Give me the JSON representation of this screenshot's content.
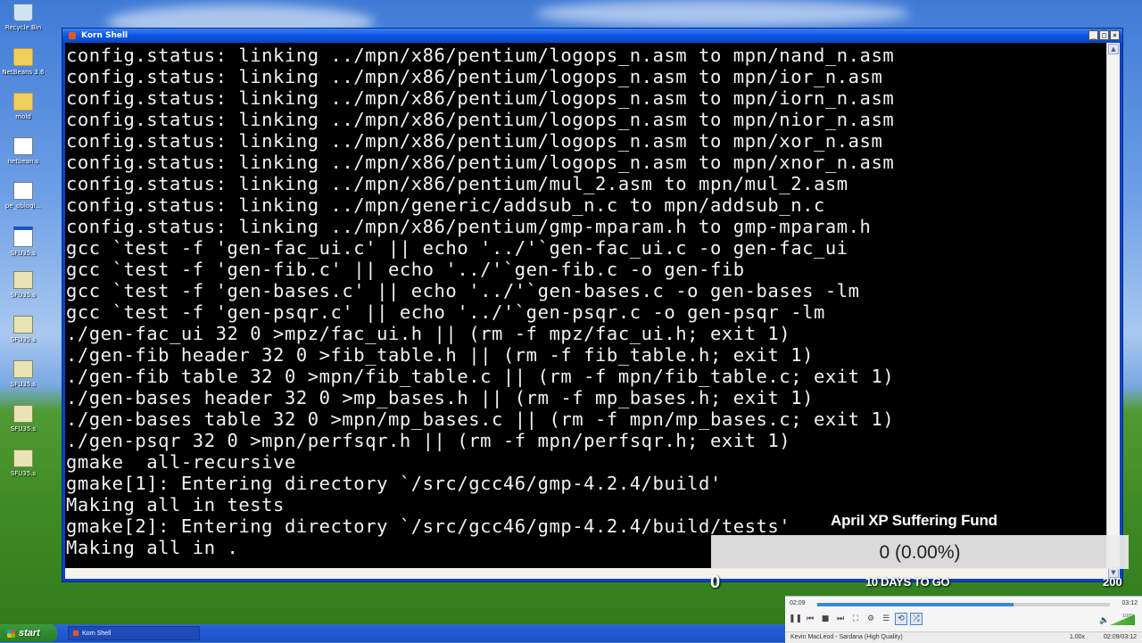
{
  "desktop": {
    "icons": [
      {
        "label": "Recycle Bin",
        "icon": "recycle-bin-icon"
      },
      {
        "label": "NetBeans 3.6",
        "icon": "folder-icon"
      },
      {
        "label": "mold",
        "icon": "folder-icon"
      },
      {
        "label": "netbean.s",
        "icon": "file-icon"
      },
      {
        "label": "pe_oblogi...",
        "icon": "file-icon"
      },
      {
        "label": "SFU35.s",
        "icon": "window-icon"
      },
      {
        "label": "SFU35.s",
        "icon": "program-icon"
      },
      {
        "label": "SFU35.s",
        "icon": "program-icon"
      },
      {
        "label": "SFU35.s",
        "icon": "program-icon"
      },
      {
        "label": "SFU35.s",
        "icon": "program-icon"
      },
      {
        "label": "SFU35.s",
        "icon": "program-icon"
      }
    ]
  },
  "window": {
    "title": "Korn Shell",
    "controls": {
      "minimize": "_",
      "maximize": "□",
      "close": "×"
    }
  },
  "terminal": {
    "lines": [
      "config.status: linking ../mpn/x86/pentium/logops_n.asm to mpn/nand_n.asm",
      "config.status: linking ../mpn/x86/pentium/logops_n.asm to mpn/ior_n.asm",
      "config.status: linking ../mpn/x86/pentium/logops_n.asm to mpn/iorn_n.asm",
      "config.status: linking ../mpn/x86/pentium/logops_n.asm to mpn/nior_n.asm",
      "config.status: linking ../mpn/x86/pentium/logops_n.asm to mpn/xor_n.asm",
      "config.status: linking ../mpn/x86/pentium/logops_n.asm to mpn/xnor_n.asm",
      "config.status: linking ../mpn/x86/pentium/mul_2.asm to mpn/mul_2.asm",
      "config.status: linking ../mpn/generic/addsub_n.c to mpn/addsub_n.c",
      "config.status: linking ../mpn/x86/pentium/gmp-mparam.h to gmp-mparam.h",
      "gcc `test -f 'gen-fac_ui.c' || echo '../'`gen-fac_ui.c -o gen-fac_ui",
      "gcc `test -f 'gen-fib.c' || echo '../'`gen-fib.c -o gen-fib",
      "gcc `test -f 'gen-bases.c' || echo '../'`gen-bases.c -o gen-bases -lm",
      "gcc `test -f 'gen-psqr.c' || echo '../'`gen-psqr.c -o gen-psqr -lm",
      "./gen-fac_ui 32 0 >mpz/fac_ui.h || (rm -f mpz/fac_ui.h; exit 1)",
      "./gen-fib header 32 0 >fib_table.h || (rm -f fib_table.h; exit 1)",
      "./gen-fib table 32 0 >mpn/fib_table.c || (rm -f mpn/fib_table.c; exit 1)",
      "./gen-bases header 32 0 >mp_bases.h || (rm -f mp_bases.h; exit 1)",
      "./gen-bases table 32 0 >mpn/mp_bases.c || (rm -f mpn/mp_bases.c; exit 1)",
      "./gen-psqr 32 0 >mpn/perfsqr.h || (rm -f mpn/perfsqr.h; exit 1)",
      "gmake  all-recursive",
      "gmake[1]: Entering directory `/src/gcc46/gmp-4.2.4/build'",
      "Making all in tests",
      "gmake[2]: Entering directory `/src/gcc46/gmp-4.2.4/build/tests'",
      "Making all in ."
    ]
  },
  "overlay": {
    "title": "April XP Suffering Fund",
    "value": "0 (0.00%)",
    "progress_fraction": 0.0,
    "min": "0",
    "days": "10 DAYS TO GO",
    "max": "200"
  },
  "player": {
    "elapsed": "02:09",
    "total": "03:12",
    "progress_fraction": 0.67,
    "volume_label": "100%",
    "song": "Kevin MacLeod - Sardana (High Quality)",
    "speed": "1.00x",
    "position": "02:09/03:12",
    "buttons": {
      "play_pause": "❚❚",
      "previous": "⏮",
      "stop": "■",
      "next": "⏭",
      "fullscreen": "⛶",
      "settings": "⚙",
      "playlist": "☰",
      "loop": "⟲",
      "shuffle": "⤮",
      "volume": "🔈"
    }
  },
  "taskbar": {
    "start_label": "start",
    "task": "Korn Shell"
  }
}
